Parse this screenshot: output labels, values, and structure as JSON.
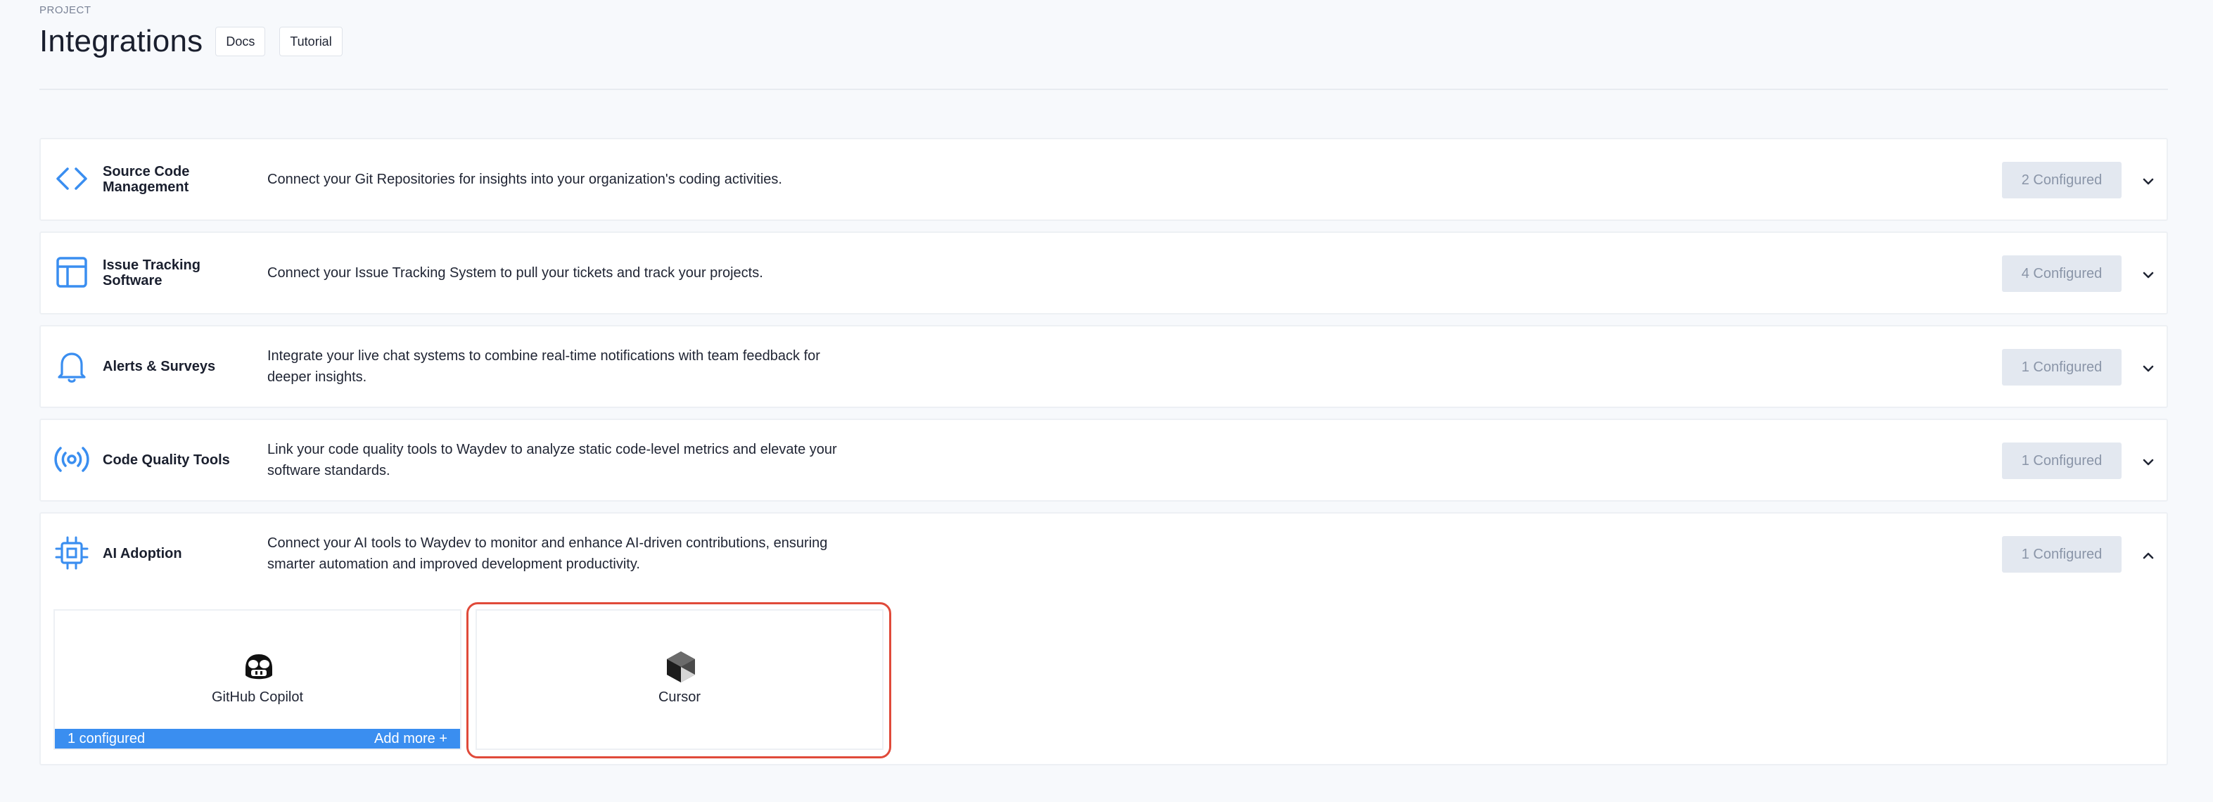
{
  "header": {
    "breadcrumb": "PROJECT",
    "title": "Integrations",
    "buttons": {
      "docs": "Docs",
      "tutorial": "Tutorial"
    }
  },
  "sections": [
    {
      "icon": "code-brackets-icon",
      "name": "Source Code Management",
      "description": "Connect your Git Repositories for insights into your organization's coding activities.",
      "status": "2 Configured",
      "expanded": false
    },
    {
      "icon": "layout-board-icon",
      "name": "Issue Tracking Software",
      "description": "Connect your Issue Tracking System to pull your tickets and track your projects.",
      "status": "4 Configured",
      "expanded": false
    },
    {
      "icon": "bell-icon",
      "name": "Alerts & Surveys",
      "description": "Integrate your live chat systems to combine real-time notifications with team feedback for deeper insights.",
      "status": "1 Configured",
      "expanded": false
    },
    {
      "icon": "broadcast-icon",
      "name": "Code Quality Tools",
      "description": "Link your code quality tools to Waydev to analyze static code-level metrics and elevate your software standards.",
      "status": "1 Configured",
      "expanded": false
    },
    {
      "icon": "cpu-chip-icon",
      "name": "AI Adoption",
      "description": "Connect your AI tools to Waydev to monitor and enhance AI-driven contributions, ensuring smarter automation and improved development productivity.",
      "status": "1 Configured",
      "expanded": true
    }
  ],
  "ai_tools": [
    {
      "icon": "github-copilot-icon",
      "name": "GitHub Copilot",
      "footer_left": "1 configured",
      "footer_right": "Add more +"
    },
    {
      "icon": "cursor-logo-icon",
      "name": "Cursor",
      "highlighted": true
    }
  ],
  "colors": {
    "accent": "#3a8ef0",
    "badge_bg": "#e3e8f0",
    "badge_text": "#8a95a8",
    "highlight": "#e04a3a"
  }
}
